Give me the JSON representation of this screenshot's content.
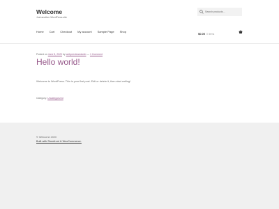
{
  "header": {
    "site_title": "Welcome",
    "site_description": "Just another WordPress site",
    "search": {
      "placeholder": "Search products…",
      "icon": "search-icon"
    },
    "nav": [
      {
        "label": "Home"
      },
      {
        "label": "Cart"
      },
      {
        "label": "Checkout"
      },
      {
        "label": "My account"
      },
      {
        "label": "Sample Page"
      },
      {
        "label": "Shop"
      }
    ],
    "cart": {
      "amount": "$0.00",
      "count": "0 items",
      "icon": "basket-icon"
    }
  },
  "post": {
    "meta": {
      "posted_on": "Posted on",
      "date": "June 5, 2020",
      "by": "by",
      "author": "webpreviewedweb",
      "separator": "—",
      "comments": "1 Comment"
    },
    "title": "Hello world!",
    "content": "Welcome to WordPress. This is your first post. Edit or delete it, then start writing!",
    "category_label": "Category:",
    "category": "Uncategorized"
  },
  "footer": {
    "copyright": "© Welcome 2020",
    "credit": "Built with Storefront & WooCommerce."
  },
  "colors": {
    "accent": "#96588a",
    "heading": "#333333",
    "text": "#6d6d6d",
    "footer_bg": "#f0f0f0"
  }
}
